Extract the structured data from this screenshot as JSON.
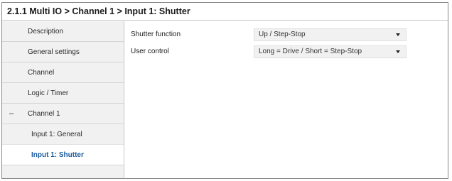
{
  "window": {
    "title": "2.1.1 Multi IO > Channel 1 > Input 1: Shutter"
  },
  "sidebar": {
    "items": [
      {
        "label": "Description"
      },
      {
        "label": "General settings"
      },
      {
        "label": "Channel"
      },
      {
        "label": "Logic / Timer"
      },
      {
        "label": "Channel 1",
        "collapse_symbol": "–"
      },
      {
        "label": "Input 1: General"
      },
      {
        "label": "Input 1: Shutter"
      }
    ]
  },
  "main": {
    "parameters": [
      {
        "label": "Shutter function",
        "value": "Up / Step-Stop"
      },
      {
        "label": "User control",
        "value": "Long = Drive / Short = Step-Stop"
      }
    ]
  },
  "colors": {
    "sidebar_bg": "#f1f1f1",
    "active_text": "#1e5c9e",
    "select_bg": "#f1f1f1"
  },
  "icons": {
    "collapse": "minus-icon",
    "dropdown": "chevron-down-icon"
  }
}
